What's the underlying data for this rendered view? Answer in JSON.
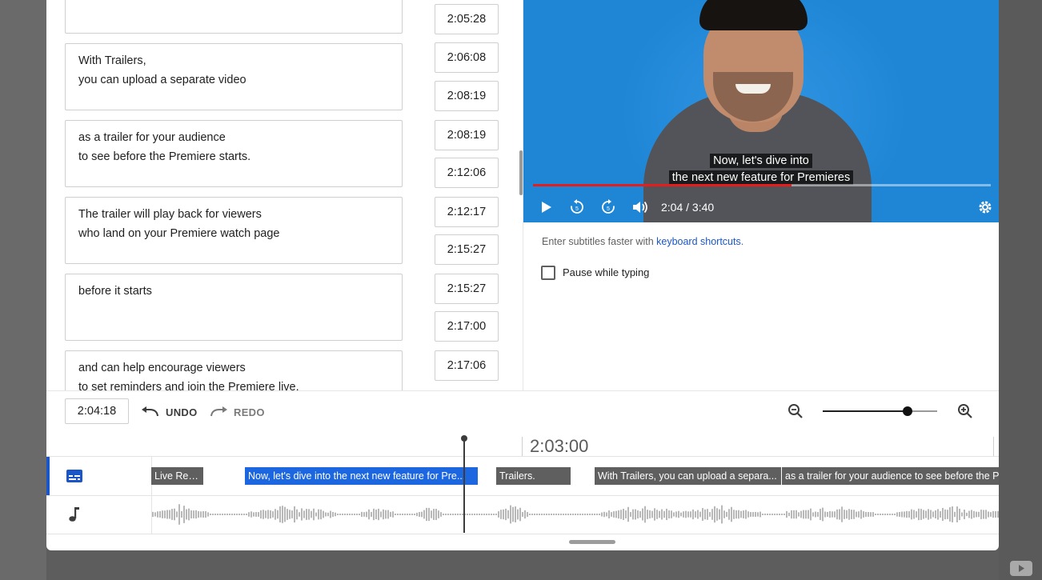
{
  "cues": [
    {
      "text": "",
      "start": "2:05:28",
      "end": ""
    },
    {
      "text": "With Trailers,\nyou can upload a separate video",
      "start": "2:06:08",
      "end": "2:08:19"
    },
    {
      "text": "as a trailer for your audience\nto see before the Premiere starts.",
      "start": "2:08:19",
      "end": "2:12:06"
    },
    {
      "text": "The trailer will play back for viewers\nwho land on your Premiere watch page",
      "start": "2:12:17",
      "end": "2:15:27"
    },
    {
      "text": "before it starts",
      "start": "2:15:27",
      "end": "2:17:00"
    },
    {
      "text": "and can help encourage viewers\nto set reminders and join the Premiere live.",
      "start": "2:17:06",
      "end": ""
    }
  ],
  "video": {
    "caption_line1": "Now, let's dive into",
    "caption_line2": "the next new feature for Premieres",
    "time_display": "2:04 / 3:40",
    "progress": 0.565,
    "colors": {
      "background": "#1f86d6",
      "progress": "#e51d1d"
    }
  },
  "hint": {
    "prefix": "Enter subtitles faster with ",
    "link": "keyboard shortcuts",
    "suffix": "."
  },
  "pause_while_typing": {
    "label": "Pause while typing",
    "checked": false
  },
  "toolbar": {
    "current_time": "2:04:18",
    "undo_label": "UNDO",
    "redo_label": "REDO",
    "zoom_level": 0.74
  },
  "timeline": {
    "ruler_label": "2:03:00",
    "subtitle_segments": [
      {
        "label": "Live Red...",
        "active": false
      },
      {
        "label": "Now, let's dive into the next new feature for Pre...",
        "active": true
      },
      {
        "label": "Trailers.",
        "active": false
      },
      {
        "label": "With Trailers, you can upload a separa...",
        "active": false
      },
      {
        "label": "as a trailer for your audience to see before the P",
        "active": false
      }
    ],
    "track_icons": {
      "subtitles": "subtitles-icon",
      "audio": "music-note-icon"
    },
    "accent": "#1a56c8"
  }
}
